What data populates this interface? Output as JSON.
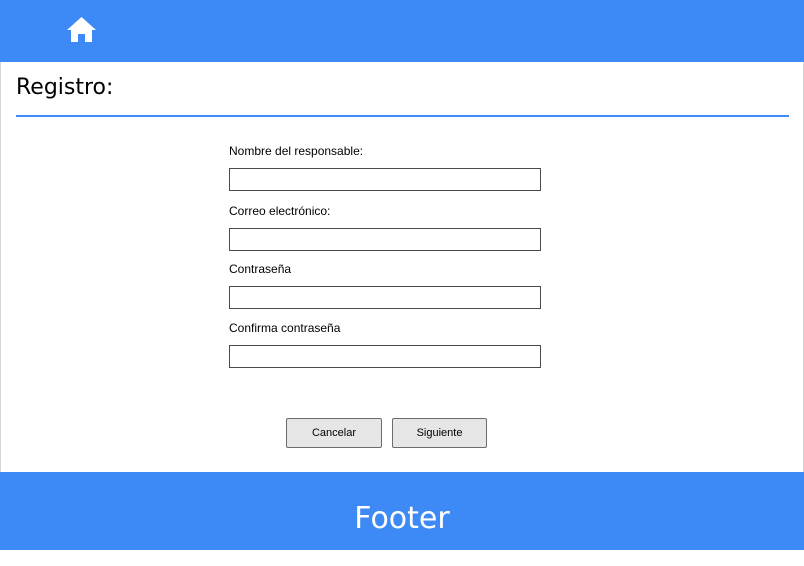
{
  "header": {
    "home_icon": "home-icon",
    "background_color": "#3d8af7"
  },
  "page": {
    "title": "Registro:"
  },
  "form": {
    "fields": [
      {
        "label": "Nombre del responsable:",
        "value": "",
        "placeholder": ""
      },
      {
        "label": "Correo electrónico:",
        "value": "",
        "placeholder": ""
      },
      {
        "label": "Contraseña",
        "value": "",
        "placeholder": ""
      },
      {
        "label": "Confirma contraseña",
        "value": "",
        "placeholder": ""
      }
    ],
    "buttons": {
      "cancel_label": "Cancelar",
      "next_label": "Siguiente"
    }
  },
  "footer": {
    "text": "Footer",
    "background_color": "#3d8af7"
  }
}
